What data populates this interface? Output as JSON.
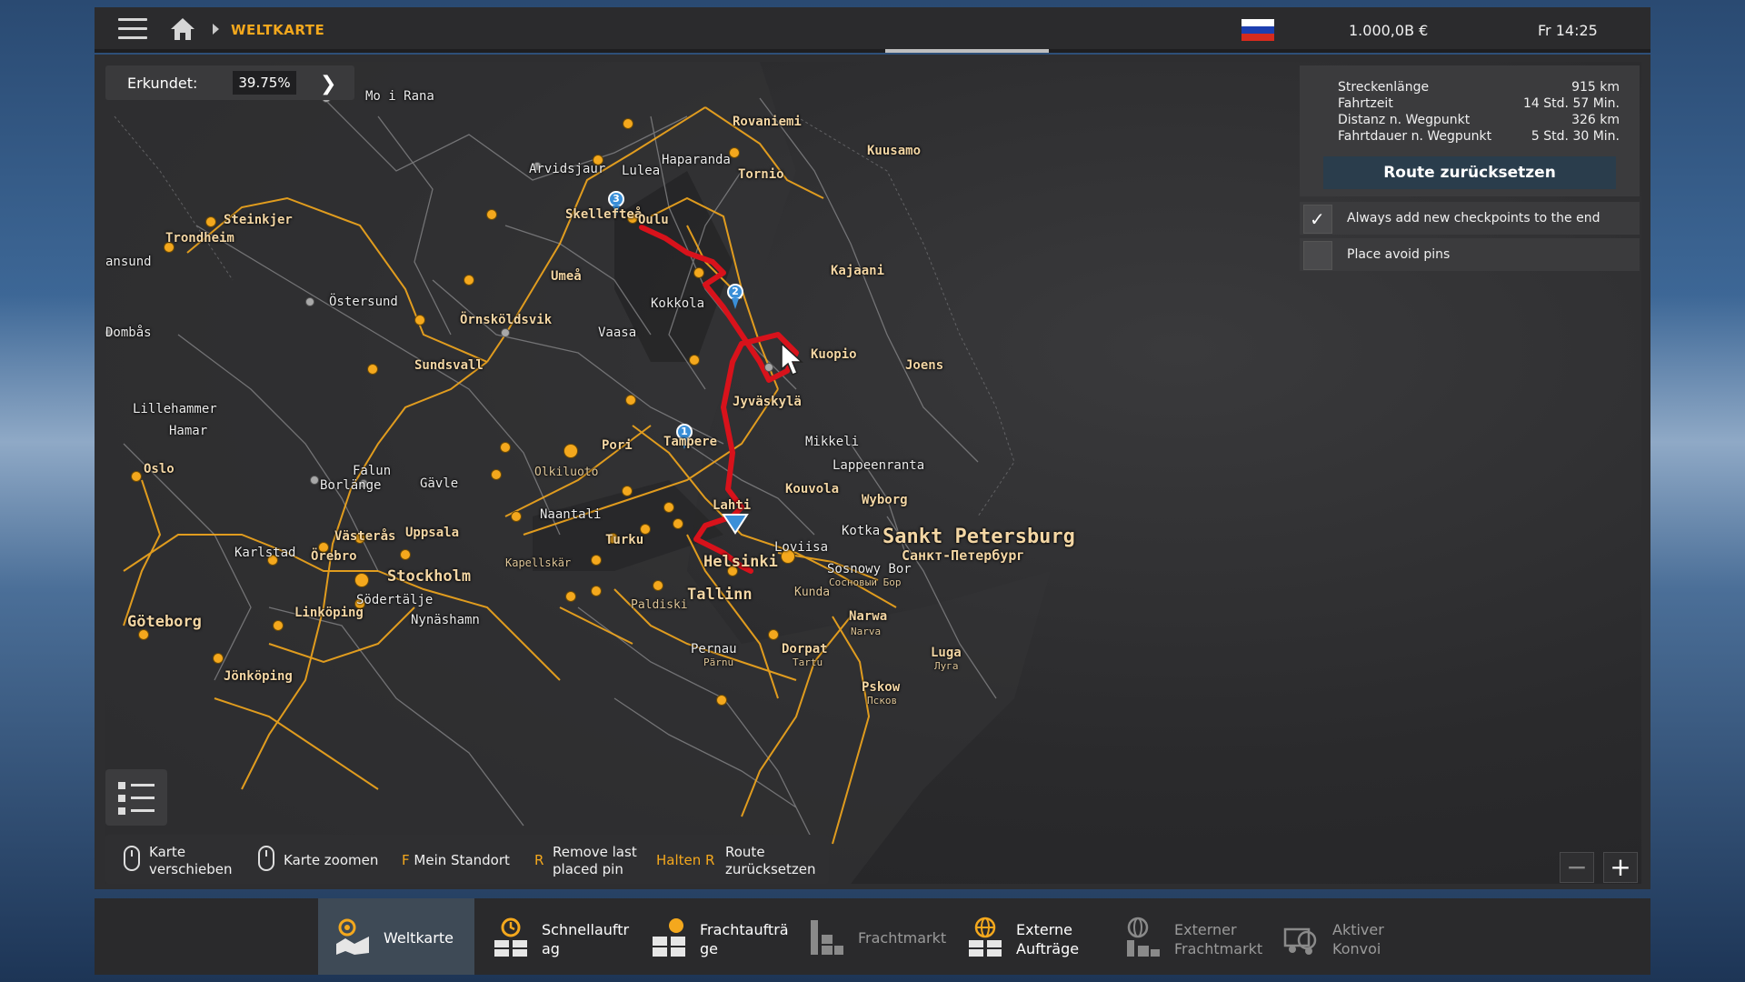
{
  "topbar": {
    "breadcrumb": "WELTKARTE",
    "money": "1.000,0B €",
    "time": "Fr 14:25"
  },
  "explored": {
    "label": "Erkundet:",
    "value": "39.75%"
  },
  "route": {
    "rows": [
      {
        "key": "Streckenlänge",
        "value": "915 km"
      },
      {
        "key": "Fahrtzeit",
        "value": "14 Std. 57 Min."
      },
      {
        "key": "Distanz n. Wegpunkt",
        "value": "326 km"
      },
      {
        "key": "Fahrtdauer n. Wegpunkt",
        "value": "5 Std. 30 Min."
      }
    ],
    "reset_label": "Route zurücksetzen"
  },
  "options": [
    {
      "label": "Always add new checkpoints to the end",
      "checked": true
    },
    {
      "label": "Place avoid pins",
      "checked": false
    }
  ],
  "hints": {
    "move": "Karte verschieben",
    "zoom": "Karte zoomen",
    "f_key": "F",
    "f_label": "Mein Standort",
    "r_key": "R",
    "r_label": "Remove last placed pin",
    "hold_key": "Halten R",
    "hold_label": "Route zurücksetzen"
  },
  "zoom": {
    "minus": "−",
    "plus": "+"
  },
  "nav": [
    {
      "label": "Weltkarte",
      "active": true,
      "icon": "map-icon"
    },
    {
      "label": "Schnellauftr ag",
      "active": false,
      "icon": "quick-job-icon"
    },
    {
      "label": "Frachtaufträ ge",
      "active": false,
      "icon": "freight-icon"
    },
    {
      "label": "Frachtmarkt",
      "active": false,
      "dim": true,
      "icon": "freight-market-icon"
    },
    {
      "label": "Externe Aufträge",
      "active": false,
      "icon": "globe-icon"
    },
    {
      "label": "Externer Frachtmarkt",
      "active": false,
      "dim": true,
      "icon": "external-market-icon"
    },
    {
      "label": "Aktiver Konvoi",
      "active": false,
      "dim": true,
      "icon": "convoy-icon"
    }
  ],
  "map": {
    "cities": [
      "Mo i Rana",
      "Rovaniemi",
      "Kuusamo",
      "Haparanda",
      "Arvidsjaur",
      "Lulea",
      "Tornio",
      "Skellefteå",
      "Oulu",
      "Steinkjer",
      "Trondheim",
      "ansund",
      "Kajaani",
      "Umeå",
      "Östersund",
      "Kokkola",
      "Örnsköldsvik",
      "Vaasa",
      "Dombås",
      "Kuopio",
      "Joens",
      "Sundsvall",
      "Jyväskylä",
      "Lillehammer",
      "Hamar",
      "Pori",
      "Tampere",
      "Mikkeli",
      "Oslo",
      "Falun",
      "Borlänge",
      "Gävle",
      "Olkiluoto",
      "Lappeenranta",
      "Kouvola",
      "Wyborg",
      "Lahti",
      "Naantali",
      "Turku",
      "Kotka",
      "Loviisa",
      "Sankt Petersburg",
      "Санкт-Петербург",
      "Karlstad",
      "Västerås",
      "Uppsala",
      "Örebro",
      "Kapellskär",
      "Helsinki",
      "Sosnowy Bor",
      "Сосновый Бор",
      "Stockholm",
      "Tallinn",
      "Kunda",
      "Södertälje",
      "Paldiski",
      "Narwa",
      "Narva",
      "Göteborg",
      "Linköping",
      "Nynäshamn",
      "Pernau",
      "Pärnu",
      "Dorpat",
      "Tartu",
      "Luga",
      "Луга",
      "Jönköping",
      "Pskow",
      "Псков"
    ],
    "waypoints": [
      "1",
      "2",
      "3"
    ]
  },
  "colors": {
    "accent": "#f4a81d",
    "route": "#d8121b",
    "pin": "#3a8fd8"
  }
}
